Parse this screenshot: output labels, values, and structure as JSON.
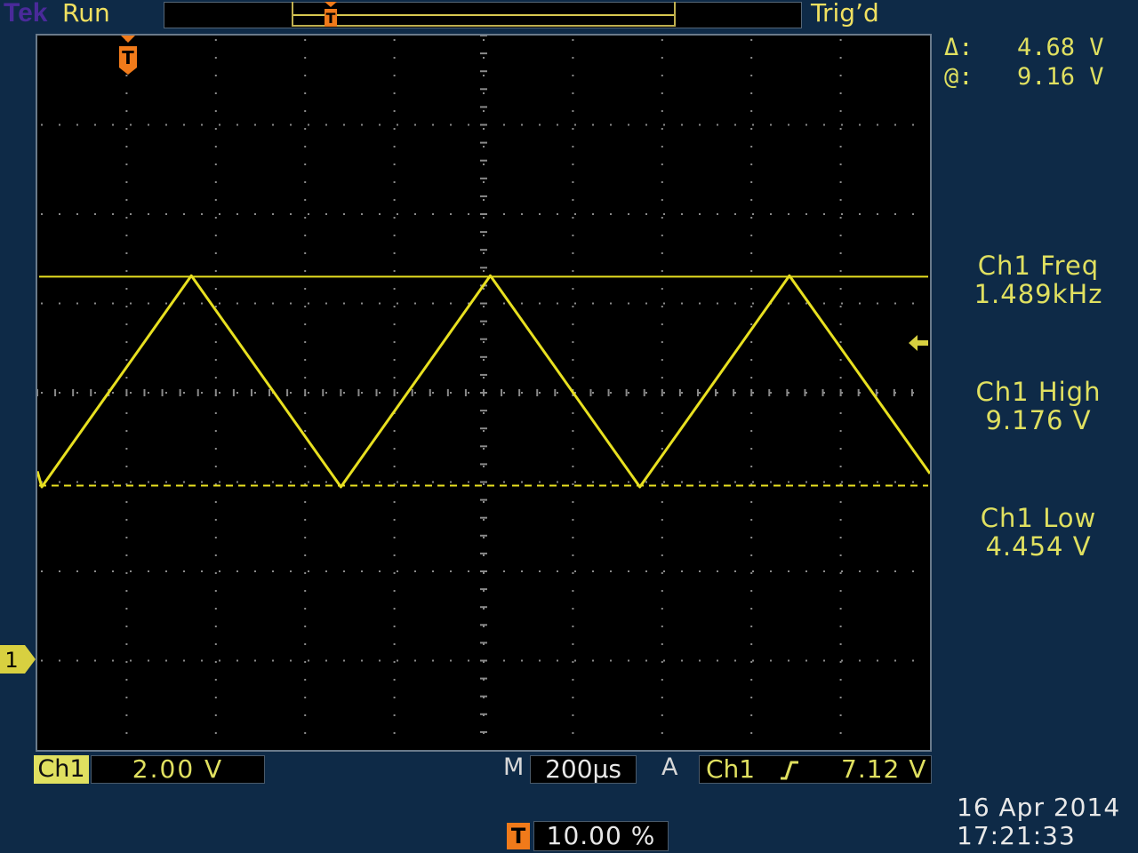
{
  "header": {
    "brand": "Tek",
    "run_status": "Run",
    "trigger_state": "Trig’d"
  },
  "cursor": {
    "delta_label": "Δ:",
    "delta_value": "4.68 V",
    "at_label": "@:",
    "at_value": "9.16 V"
  },
  "measurements": [
    {
      "label": "Ch1 Freq",
      "value": "1.489kHz"
    },
    {
      "label": "Ch1 High",
      "value": "9.176 V"
    },
    {
      "label": "Ch1 Low",
      "value": "4.454 V"
    }
  ],
  "bottom": {
    "channel_badge": "Ch1",
    "vertical_scale": "2.00 V",
    "m_label": "M",
    "horizontal_scale": "200µs",
    "a_label": "A",
    "trigger_source": "Ch1",
    "trigger_level": "7.12 V",
    "trigger_position": "10.00 %",
    "trigger_icon": "T",
    "date": "16 Apr  2014",
    "time": "17:21:33"
  },
  "markers": {
    "channel_marker": "1",
    "trigger_marker": "T"
  },
  "colors": {
    "trace": "#e8e020",
    "background": "#0e2a47",
    "trigger": "#f07a1a"
  },
  "chart_data": {
    "type": "line",
    "title": "",
    "xlabel": "",
    "ylabel": "",
    "volts_per_div": 2.0,
    "seconds_per_div": 0.0002,
    "ylim": [
      -1.44,
      14.56
    ],
    "xlim": [
      -0.0002,
      0.0018
    ],
    "grid": true,
    "series": [
      {
        "x": [
          -0.0002,
          -0.00019,
          0.000145,
          0.00048,
          0.000815,
          0.00115,
          0.001485,
          0.0018
        ],
        "y": [
          4.8,
          4.45,
          9.18,
          4.45,
          9.18,
          4.45,
          9.18,
          4.75
        ]
      }
    ],
    "cursor_lines": [
      9.16,
      4.48
    ]
  }
}
